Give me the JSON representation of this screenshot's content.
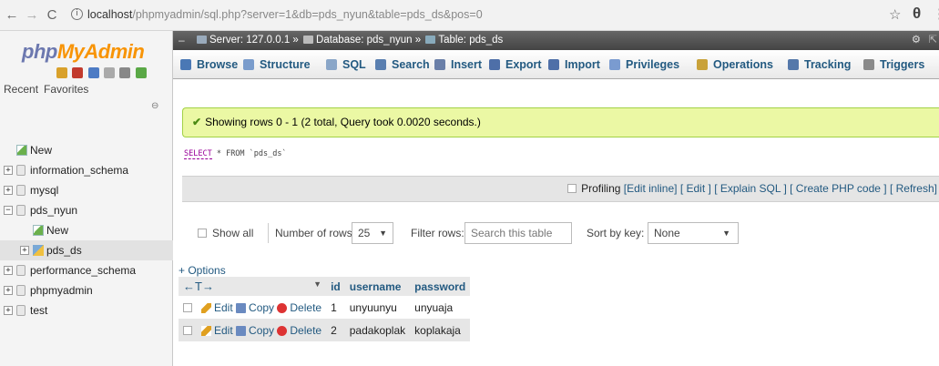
{
  "browser": {
    "url_host": "localhost",
    "url_path": "/phpmyadmin/sql.php?server=1&db=pds_nyun&table=pds_ds&pos=0"
  },
  "sidebar": {
    "logo_php": "php",
    "logo_myadmin": "MyAdmin",
    "tab_recent": "Recent",
    "tab_favorites": "Favorites",
    "tree": [
      {
        "label": "New",
        "level": 0,
        "kind": "new"
      },
      {
        "label": "information_schema",
        "level": 0,
        "kind": "db"
      },
      {
        "label": "mysql",
        "level": 0,
        "kind": "db"
      },
      {
        "label": "pds_nyun",
        "level": 0,
        "kind": "db-open"
      },
      {
        "label": "New",
        "level": 1,
        "kind": "new"
      },
      {
        "label": "pds_ds",
        "level": 1,
        "kind": "table"
      },
      {
        "label": "performance_schema",
        "level": 0,
        "kind": "db"
      },
      {
        "label": "phpmyadmin",
        "level": 0,
        "kind": "db"
      },
      {
        "label": "test",
        "level": 0,
        "kind": "db"
      }
    ]
  },
  "breadcrumb": {
    "server": "Server: 127.0.0.1 »",
    "database": "Database: pds_nyun »",
    "table": "Table: pds_ds"
  },
  "tabs": [
    {
      "label": "Browse",
      "icon": "browse-icon",
      "color": "#4a78b5"
    },
    {
      "label": "Structure",
      "icon": "structure-icon",
      "color": "#7a9ccc"
    },
    {
      "label": "SQL",
      "icon": "sql-icon",
      "color": "#8aa6c8"
    },
    {
      "label": "Search",
      "icon": "search-icon",
      "color": "#5a7fb0"
    },
    {
      "label": "Insert",
      "icon": "insert-icon",
      "color": "#6a7fa8"
    },
    {
      "label": "Export",
      "icon": "export-icon",
      "color": "#4e6fa8"
    },
    {
      "label": "Import",
      "icon": "import-icon",
      "color": "#4e6fa8"
    },
    {
      "label": "Privileges",
      "icon": "privileges-icon",
      "color": "#7a9bd0"
    },
    {
      "label": "Operations",
      "icon": "operations-icon",
      "color": "#c9a23a"
    },
    {
      "label": "Tracking",
      "icon": "tracking-icon",
      "color": "#5578aa"
    },
    {
      "label": "Triggers",
      "icon": "triggers-icon",
      "color": "#8a8a8a"
    }
  ],
  "success_message": "Showing rows 0 - 1 (2 total, Query took 0.0020 seconds.)",
  "sql_keyword": "SELECT",
  "sql_rest": " * FROM `pds_ds`",
  "profiling": {
    "label": "Profiling",
    "links": [
      "[Edit inline]",
      "[ Edit ]",
      "[ Explain SQL ]",
      "[ Create PHP code ]",
      "[ Refresh]"
    ]
  },
  "nav": {
    "show_all": "Show all",
    "number_of_rows_label": "Number of rows:",
    "number_of_rows_value": "25",
    "filter_label": "Filter rows:",
    "filter_placeholder": "Search this table",
    "sort_label": "Sort by key:",
    "sort_value": "None"
  },
  "options_link": "+ Options",
  "table": {
    "columns": [
      "id",
      "username",
      "password"
    ],
    "action_labels": {
      "edit": "Edit",
      "copy": "Copy",
      "delete": "Delete"
    },
    "rows": [
      {
        "id": "1",
        "username": "unyuunyu",
        "password": "unyuaja"
      },
      {
        "id": "2",
        "username": "padakoplak",
        "password": "koplakaja"
      }
    ]
  }
}
